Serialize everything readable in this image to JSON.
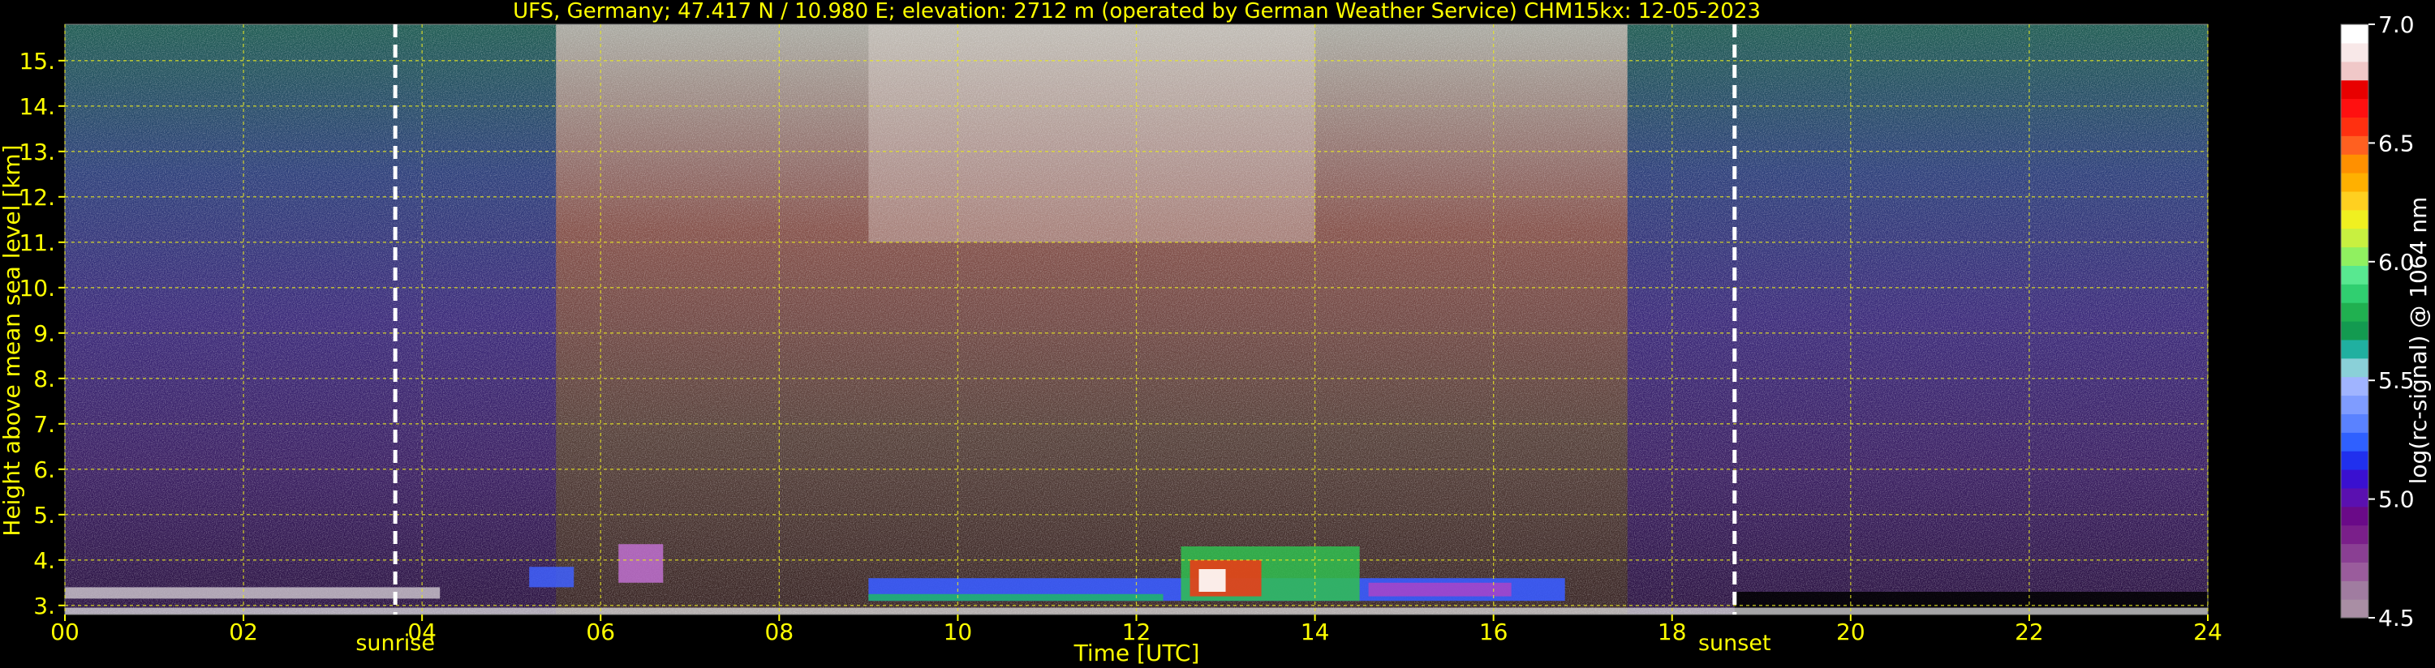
{
  "chart_data": {
    "type": "heatmap",
    "title": "UFS, Germany; 47.417 N / 10.980 E; elevation: 2712 m  (operated by German Weather Service)    CHM15kx: 12-05-2023",
    "xlabel": "Time [UTC]",
    "ylabel": "Height above mean sea level [km]",
    "xlim": [
      0,
      24
    ],
    "ylim": [
      2.8,
      15.8
    ],
    "x_ticks": [
      "00",
      "02",
      "04",
      "06",
      "08",
      "10",
      "12",
      "14",
      "16",
      "18",
      "20",
      "22",
      "24"
    ],
    "y_ticks": [
      "3.",
      "4.",
      "5.",
      "6.",
      "7.",
      "8.",
      "9.",
      "10.",
      "11.",
      "12.",
      "13.",
      "14.",
      "15."
    ],
    "grid": true,
    "colorbar": {
      "label": "log(rc-signal) @ 1064 nm",
      "range": [
        4.5,
        7.0
      ],
      "ticks": [
        "4.5",
        "5.0",
        "5.5",
        "6.0",
        "6.5",
        "7.0"
      ],
      "colors": [
        "#a98ea4",
        "#a07ca0",
        "#9a5c9c",
        "#8a3f93",
        "#7a1f8a",
        "#6a0a88",
        "#5a10b0",
        "#3a10d0",
        "#2030ee",
        "#2f60ff",
        "#5a82ff",
        "#7f9cff",
        "#a0b4ff",
        "#8ad0d8",
        "#20b0a0",
        "#139a50",
        "#20b050",
        "#30cf70",
        "#58e890",
        "#90f060",
        "#c8f040",
        "#f0f020",
        "#ffd020",
        "#ffb000",
        "#ff9000",
        "#ff6020",
        "#ff3010",
        "#ff1010",
        "#e80000",
        "#f0c8c8",
        "#f8e8e8",
        "#ffffff"
      ]
    },
    "markers": [
      {
        "label": "sunrise",
        "x": 3.7
      },
      {
        "label": "sunset",
        "x": 18.7
      }
    ]
  }
}
